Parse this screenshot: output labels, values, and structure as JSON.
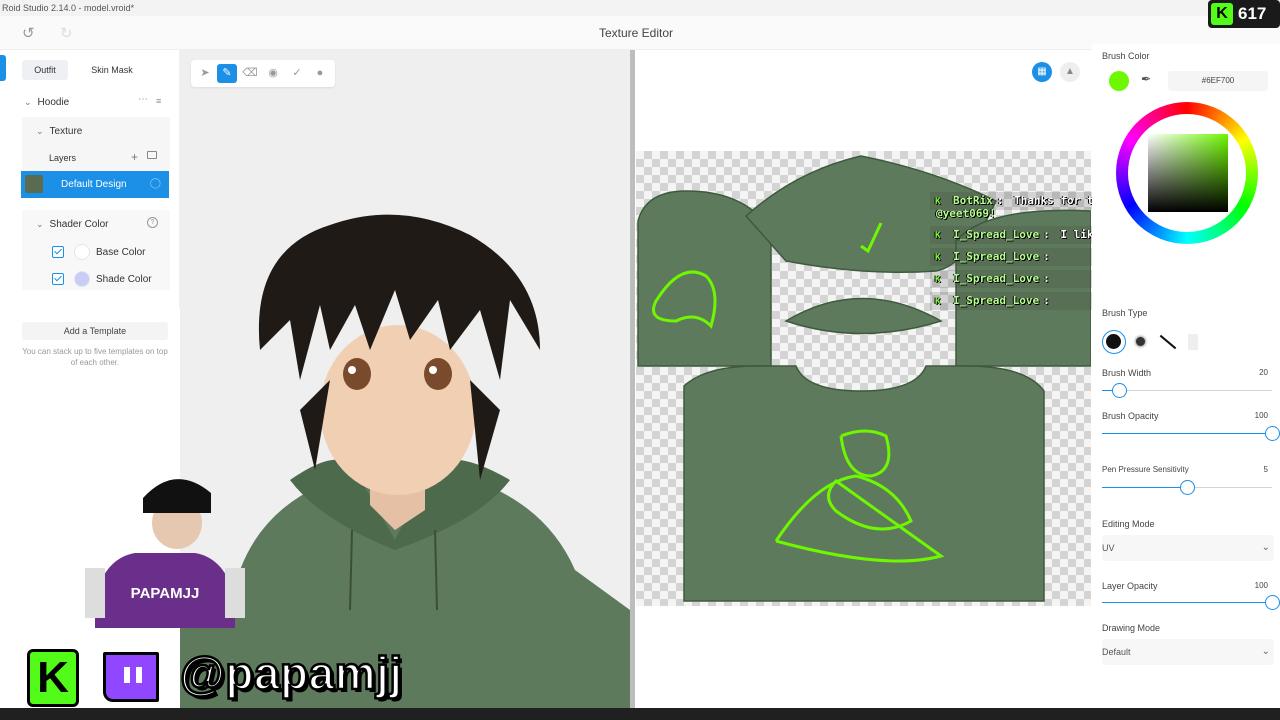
{
  "app": {
    "window_title": "Roid Studio 2.14.0 - model.vroid*",
    "header_title": "Texture Editor"
  },
  "left_panel": {
    "tabs": [
      "Outfit",
      "Skin Mask"
    ],
    "item": "Hoodie",
    "section": "Texture",
    "layers_label": "Layers",
    "selected_layer": "Default Design",
    "shader_label": "Shader Color",
    "base_color_label": "Base Color",
    "shade_color_label": "Shade Color",
    "add_template_label": "Add a Template",
    "template_hint": "You can stack up to five templates on top of each other."
  },
  "right_panel": {
    "brush_color_label": "Brush Color",
    "brush_color_hex": "#6EF700",
    "brush_type_label": "Brush Type",
    "brush_width_label": "Brush Width",
    "brush_width_value": "20",
    "brush_width": 20,
    "brush_opacity_label": "Brush Opacity",
    "brush_opacity_value": "100",
    "brush_opacity": 100,
    "pen_pressure_label": "Pen Pressure Sensitivity",
    "pen_pressure_value": "5",
    "pen_pressure": 5,
    "editing_mode_label": "Editing Mode",
    "editing_mode_value": "UV",
    "layer_opacity_label": "Layer Opacity",
    "layer_opacity_value": "100",
    "layer_opacity": 100,
    "drawing_mode_label": "Drawing Mode",
    "drawing_mode_value": "Default"
  },
  "chat": [
    {
      "user": "BotRix",
      "message": "Thanks for the follow"
    },
    {
      "user": "@yeet069!",
      "message": ""
    },
    {
      "user": "I_Spread_Love",
      "message": "I like your hat"
    },
    {
      "user": "I_Spread_Love",
      "message": ""
    },
    {
      "user": "I_Spread_Love",
      "message": ""
    },
    {
      "user": "I_Spread_Love",
      "message": ""
    }
  ],
  "stream": {
    "viewer_count": "617",
    "handle": "@papamjj",
    "avatar_shirt_text": "PAPAMJJ"
  },
  "colors": {
    "accent": "#1c8fe6",
    "brush": "#6EF700",
    "hoodie": "#5e7a5c",
    "shade_color": "#c9ccf7",
    "kick_green": "#53fc18",
    "twitch_purple": "#9146ff"
  },
  "icons": [
    "undo-icon",
    "redo-icon",
    "select-icon",
    "pen-icon",
    "eraser-icon",
    "fill-icon",
    "picker-icon",
    "blur-icon",
    "grid-icon",
    "mirror-icon",
    "eyedropper-icon",
    "add-layer-icon",
    "image-layer-icon",
    "more-icon",
    "settings-icon",
    "help-icon",
    "eye-icon"
  ]
}
